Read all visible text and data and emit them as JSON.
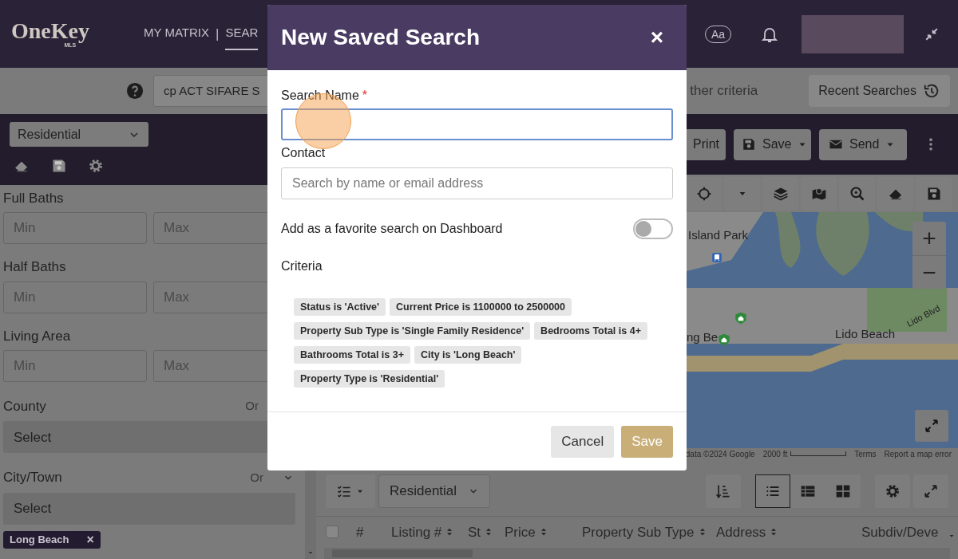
{
  "header": {
    "logo": {
      "left": "One",
      "right": "Key",
      "sub": "MLS"
    },
    "nav": [
      {
        "label": "MY MATRIX",
        "selected": false
      },
      {
        "label": "SEAR",
        "selected": true
      }
    ],
    "nav_separator": "|",
    "font_button": "Aa"
  },
  "search_bar": {
    "query": "cp ACT SIFARE S",
    "criteria_hint": "ther criteria",
    "recent_button": "Recent Searches"
  },
  "sidebar": {
    "type_dropdown": "Residential",
    "ranges": [
      {
        "label": "Full Baths",
        "min_placeholder": "Min",
        "max_placeholder": "Max"
      },
      {
        "label": "Half Baths",
        "min_placeholder": "Min",
        "max_placeholder": "Max"
      },
      {
        "label": "Living Area",
        "min_placeholder": "Min",
        "max_placeholder": "Max"
      }
    ],
    "selects": [
      {
        "label": "County",
        "mode": "Or",
        "placeholder": "Select",
        "expandable": false
      },
      {
        "label": "City/Town",
        "mode": "Or",
        "placeholder": "Select",
        "expandable": true,
        "tags": [
          {
            "label": "Long Beach",
            "remove": "×"
          }
        ]
      }
    ]
  },
  "toolbar": {
    "buttons": [
      {
        "label": "Print",
        "kind": "plain"
      },
      {
        "label": "Save",
        "kind": "save"
      },
      {
        "label": "Send",
        "kind": "send"
      }
    ]
  },
  "map": {
    "labels": [
      {
        "text": "Island Park",
        "kind": "place"
      },
      {
        "text": "ng Be",
        "kind": "place"
      },
      {
        "text": "Lido Beach",
        "kind": "place"
      },
      {
        "text": "Lido Blvd",
        "kind": "road"
      }
    ],
    "zoom_in": "+",
    "zoom_out": "−",
    "attribution": [
      "data ©2024 Google",
      "2000 ft",
      "Terms",
      "Report a map error"
    ]
  },
  "results": {
    "view_dropdown": "Residential",
    "select_all": {
      "checked": false
    },
    "view_modes": [
      {
        "kind": "list",
        "selected": true
      },
      {
        "kind": "table",
        "selected": false
      },
      {
        "kind": "grid",
        "selected": false
      }
    ],
    "columns": [
      {
        "label": "#",
        "sortable": false
      },
      {
        "label": "Listing #",
        "sortable": true
      },
      {
        "label": "St",
        "sortable": true
      },
      {
        "label": "Price",
        "sortable": true
      },
      {
        "label": "Property Sub Type",
        "sortable": true
      },
      {
        "label": "Address",
        "sortable": true
      },
      {
        "label": "Subdiv/Deve",
        "sortable": false
      }
    ]
  },
  "modal": {
    "title": "New Saved Search",
    "close": "×",
    "search_name": {
      "label": "Search Name",
      "required": true,
      "required_mark": "*"
    },
    "contact": {
      "label": "Contact",
      "placeholder": "Search by name or email address"
    },
    "favorite": {
      "label": "Add as a favorite search on Dashboard",
      "on": false
    },
    "criteria_label": "Criteria",
    "criteria": [
      "Status is 'Active'",
      "Current Price is 1100000 to 2500000",
      "Property Sub Type is 'Single Family Residence'",
      "Bedrooms Total is 4+",
      "Bathrooms Total is 3+",
      "City is 'Long Beach'",
      "Property Type is 'Residential'"
    ],
    "buttons": [
      {
        "label": "Cancel",
        "kind": "secondary"
      },
      {
        "label": "Save",
        "kind": "primary"
      }
    ]
  }
}
